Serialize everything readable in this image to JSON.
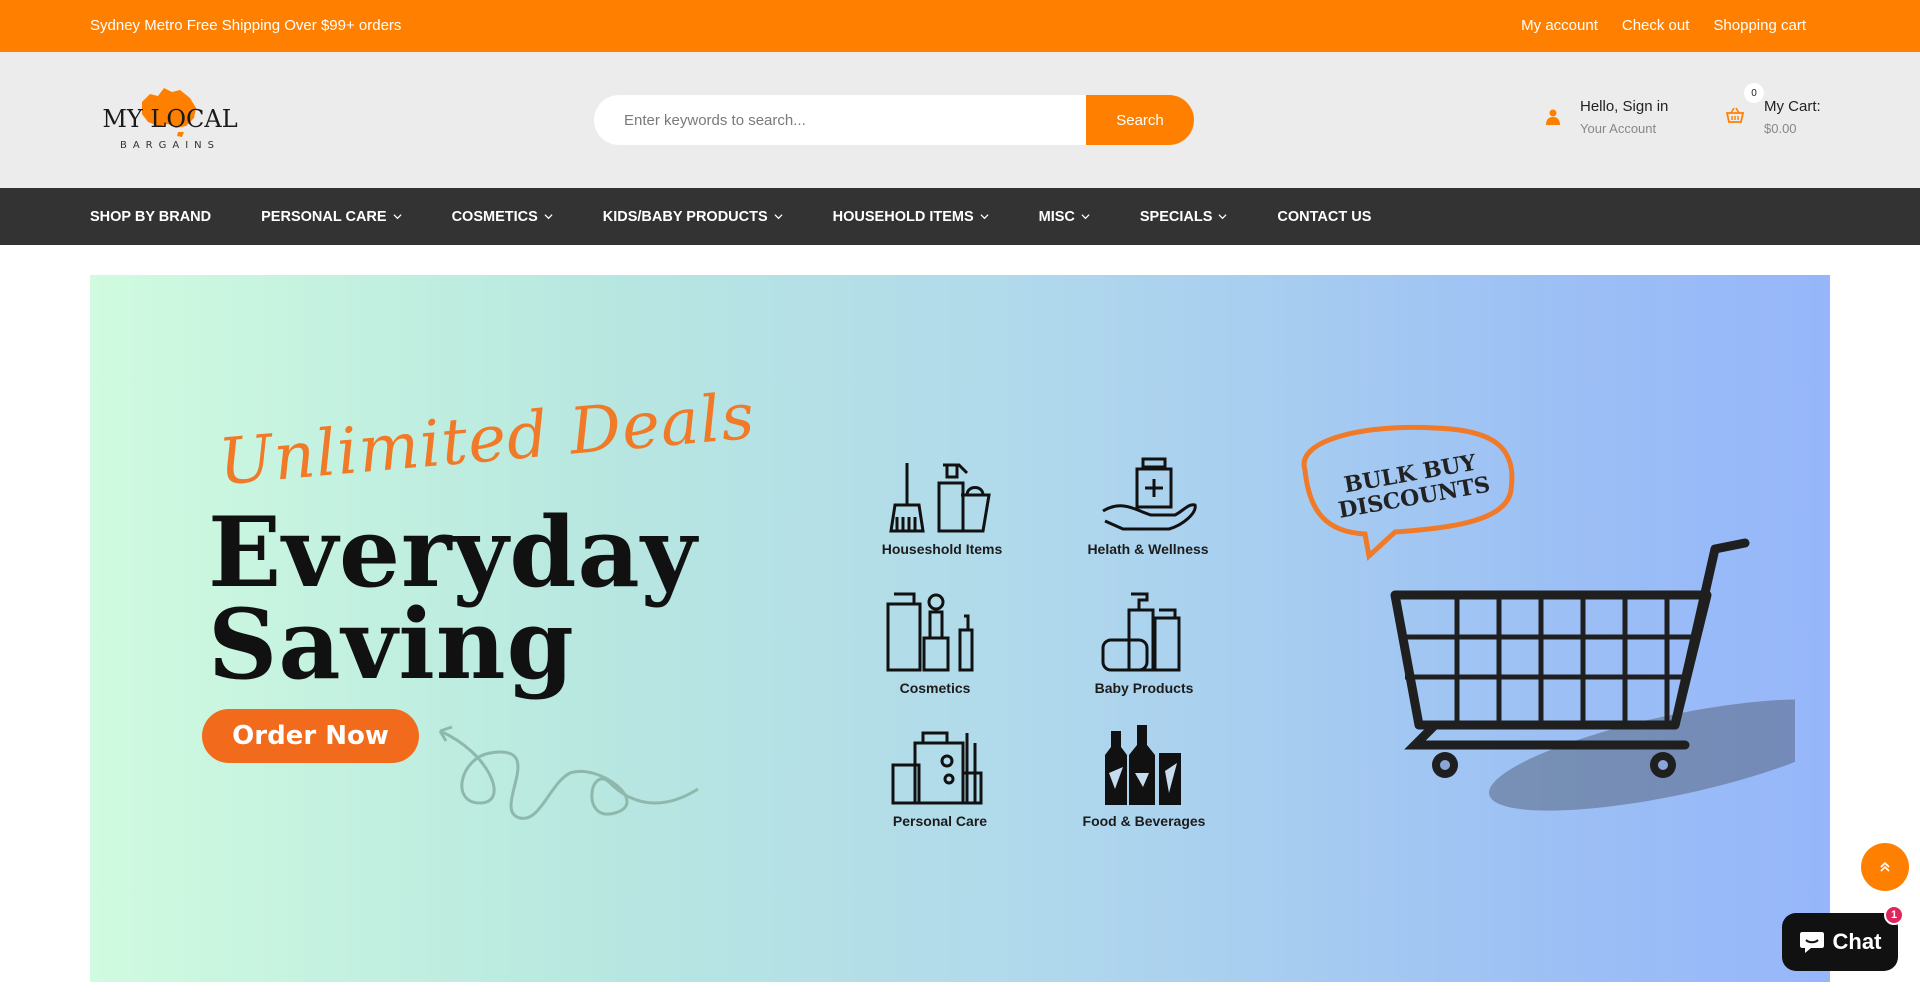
{
  "topbar": {
    "promo": "Sydney Metro Free Shipping Over $99+ orders",
    "links": [
      "My account",
      "Check out",
      "Shopping cart"
    ]
  },
  "header": {
    "logo_text_main": "MY LOCAL",
    "logo_text_sub": "BARGAINS",
    "search_placeholder": "Enter keywords to search...",
    "search_button": "Search",
    "account_line1": "Hello, Sign in",
    "account_line2": "Your Account",
    "cart_count": "0",
    "cart_line1": "My Cart:",
    "cart_line2": "$0.00"
  },
  "nav": {
    "items": [
      {
        "label": "SHOP BY BRAND",
        "dropdown": false
      },
      {
        "label": "PERSONAL CARE",
        "dropdown": true
      },
      {
        "label": "COSMETICS",
        "dropdown": true
      },
      {
        "label": "KIDS/BABY PRODUCTS",
        "dropdown": true
      },
      {
        "label": "HOUSEHOLD ITEMS",
        "dropdown": true
      },
      {
        "label": "MISC",
        "dropdown": true
      },
      {
        "label": "SPECIALS",
        "dropdown": true
      },
      {
        "label": "CONTACT US",
        "dropdown": false
      }
    ]
  },
  "banner": {
    "script_text": "Unlimited Deals",
    "headline_1": "Everyday",
    "headline_2": "Saving",
    "cta": "Order Now",
    "bubble_line1": "BULK BUY",
    "bubble_line2": "DISCOUNTS",
    "categories": [
      {
        "label": "Houseshold Items",
        "icon": "cleaning-supplies-icon"
      },
      {
        "label": "Helath & Wellness",
        "icon": "hand-medicine-icon"
      },
      {
        "label": "Cosmetics",
        "icon": "cosmetics-icon"
      },
      {
        "label": "Baby Products",
        "icon": "baby-products-icon"
      },
      {
        "label": "Personal Care",
        "icon": "personal-care-icon"
      },
      {
        "label": "Food & Beverages",
        "icon": "bottles-icon"
      }
    ]
  },
  "chat": {
    "label": "Chat",
    "badge": "1"
  },
  "colors": {
    "brand_orange": "#ff8000",
    "nav_bg": "#333333",
    "header_bg": "#ececec",
    "cta_orange": "#f26a1b"
  }
}
